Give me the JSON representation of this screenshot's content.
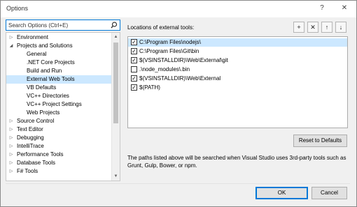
{
  "window": {
    "title": "Options"
  },
  "titlebar": {
    "help_label": "?",
    "close_label": "✕"
  },
  "search": {
    "placeholder": "Search Options (Ctrl+E)"
  },
  "tree": {
    "items": [
      {
        "label": "Environment",
        "twisty": "▷",
        "indent": 0,
        "selected": false
      },
      {
        "label": "Projects and Solutions",
        "twisty": "◢",
        "indent": 0,
        "selected": false
      },
      {
        "label": "General",
        "twisty": "",
        "indent": 1,
        "selected": false
      },
      {
        "label": ".NET Core Projects",
        "twisty": "",
        "indent": 1,
        "selected": false
      },
      {
        "label": "Build and Run",
        "twisty": "",
        "indent": 1,
        "selected": false
      },
      {
        "label": "External Web Tools",
        "twisty": "",
        "indent": 1,
        "selected": true
      },
      {
        "label": "VB Defaults",
        "twisty": "",
        "indent": 1,
        "selected": false
      },
      {
        "label": "VC++ Directories",
        "twisty": "",
        "indent": 1,
        "selected": false
      },
      {
        "label": "VC++ Project Settings",
        "twisty": "",
        "indent": 1,
        "selected": false
      },
      {
        "label": "Web Projects",
        "twisty": "",
        "indent": 1,
        "selected": false
      },
      {
        "label": "Source Control",
        "twisty": "▷",
        "indent": 0,
        "selected": false
      },
      {
        "label": "Text Editor",
        "twisty": "▷",
        "indent": 0,
        "selected": false
      },
      {
        "label": "Debugging",
        "twisty": "▷",
        "indent": 0,
        "selected": false
      },
      {
        "label": "IntelliTrace",
        "twisty": "▷",
        "indent": 0,
        "selected": false
      },
      {
        "label": "Performance Tools",
        "twisty": "▷",
        "indent": 0,
        "selected": false
      },
      {
        "label": "Database Tools",
        "twisty": "▷",
        "indent": 0,
        "selected": false
      },
      {
        "label": "F# Tools",
        "twisty": "▷",
        "indent": 0,
        "selected": false
      }
    ]
  },
  "right": {
    "label": "Locations of external tools:",
    "paths": [
      {
        "text": "C:\\Program Files\\nodejs\\",
        "checked": true,
        "selected": true
      },
      {
        "text": "C:\\Program Files\\Git\\bin",
        "checked": true,
        "selected": false
      },
      {
        "text": "$(VSINSTALLDIR)\\Web\\External\\git",
        "checked": true,
        "selected": false
      },
      {
        "text": ".\\node_modules\\.bin",
        "checked": false,
        "selected": false
      },
      {
        "text": "$(VSINSTALLDIR)\\Web\\External",
        "checked": true,
        "selected": false
      },
      {
        "text": "$(PATH)",
        "checked": true,
        "selected": false
      }
    ],
    "reset_label": "Reset to Defaults",
    "description": "The paths listed above will be searched when Visual Studio uses 3rd-party tools such as Grunt, Gulp, Bower, or npm."
  },
  "toolbar": {
    "buttons": [
      {
        "name": "add-path-icon",
        "glyph": "+"
      },
      {
        "name": "remove-path-icon",
        "glyph": "✕"
      },
      {
        "name": "move-up-icon",
        "glyph": "↑"
      },
      {
        "name": "move-down-icon",
        "glyph": "↓"
      }
    ]
  },
  "footer": {
    "ok_label": "OK",
    "cancel_label": "Cancel"
  },
  "colors": {
    "accent": "#0078d7",
    "selection": "#cce8ff"
  }
}
